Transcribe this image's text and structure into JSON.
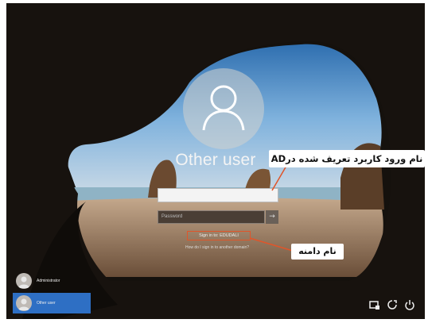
{
  "login": {
    "title": "Other user",
    "username_value": "",
    "password_placeholder": "Password",
    "submit_glyph": "→",
    "sign_in_to": "Sign in to: EDUDALI",
    "how_to_sign_in": "How do I sign in to another domain?"
  },
  "annotations": {
    "ad_callout": "نام ورود کاربرد تعریف شده درAD",
    "domain_callout": "نام دامنه",
    "highlight_color": "#e0552a"
  },
  "users": [
    {
      "name": "Administrator",
      "selected": false
    },
    {
      "name": "Other user",
      "selected": true
    }
  ],
  "system_icons": [
    "network-icon",
    "accessibility-icon",
    "power-icon"
  ]
}
